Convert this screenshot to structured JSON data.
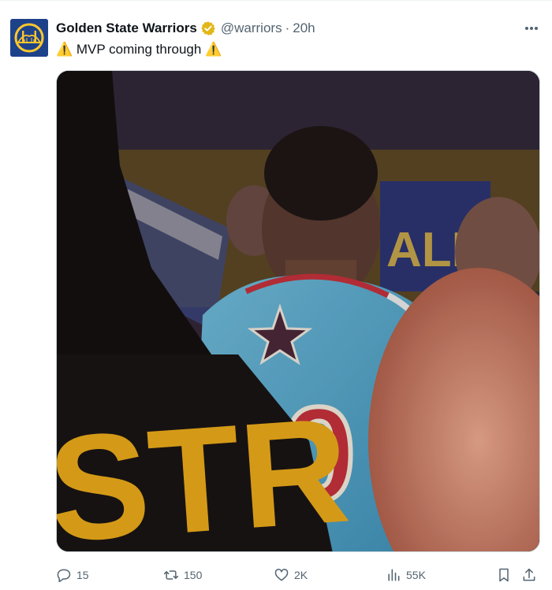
{
  "tweet": {
    "display_name": "Golden State Warriors",
    "handle": "@warriors",
    "separator": "·",
    "time": "20h",
    "text": "⚠️ MVP coming through ⚠️",
    "colors": {
      "avatar_bg": "#1d428a",
      "avatar_gold": "#ffc72c",
      "verified_gold": "#e2b719",
      "secondary_text": "#536471"
    },
    "media": {
      "description_icon": "video-still-image",
      "jersey_number": "0",
      "banner_text": "ALL-S",
      "shirt_text": "STR"
    },
    "actions": {
      "replies": "15",
      "retweets": "150",
      "likes": "2K",
      "views": "55K"
    },
    "icons": [
      "avatar-logo-icon",
      "verified-badge-icon",
      "more-icon",
      "reply-icon",
      "retweet-icon",
      "like-icon",
      "views-icon",
      "bookmark-icon",
      "share-icon"
    ]
  }
}
